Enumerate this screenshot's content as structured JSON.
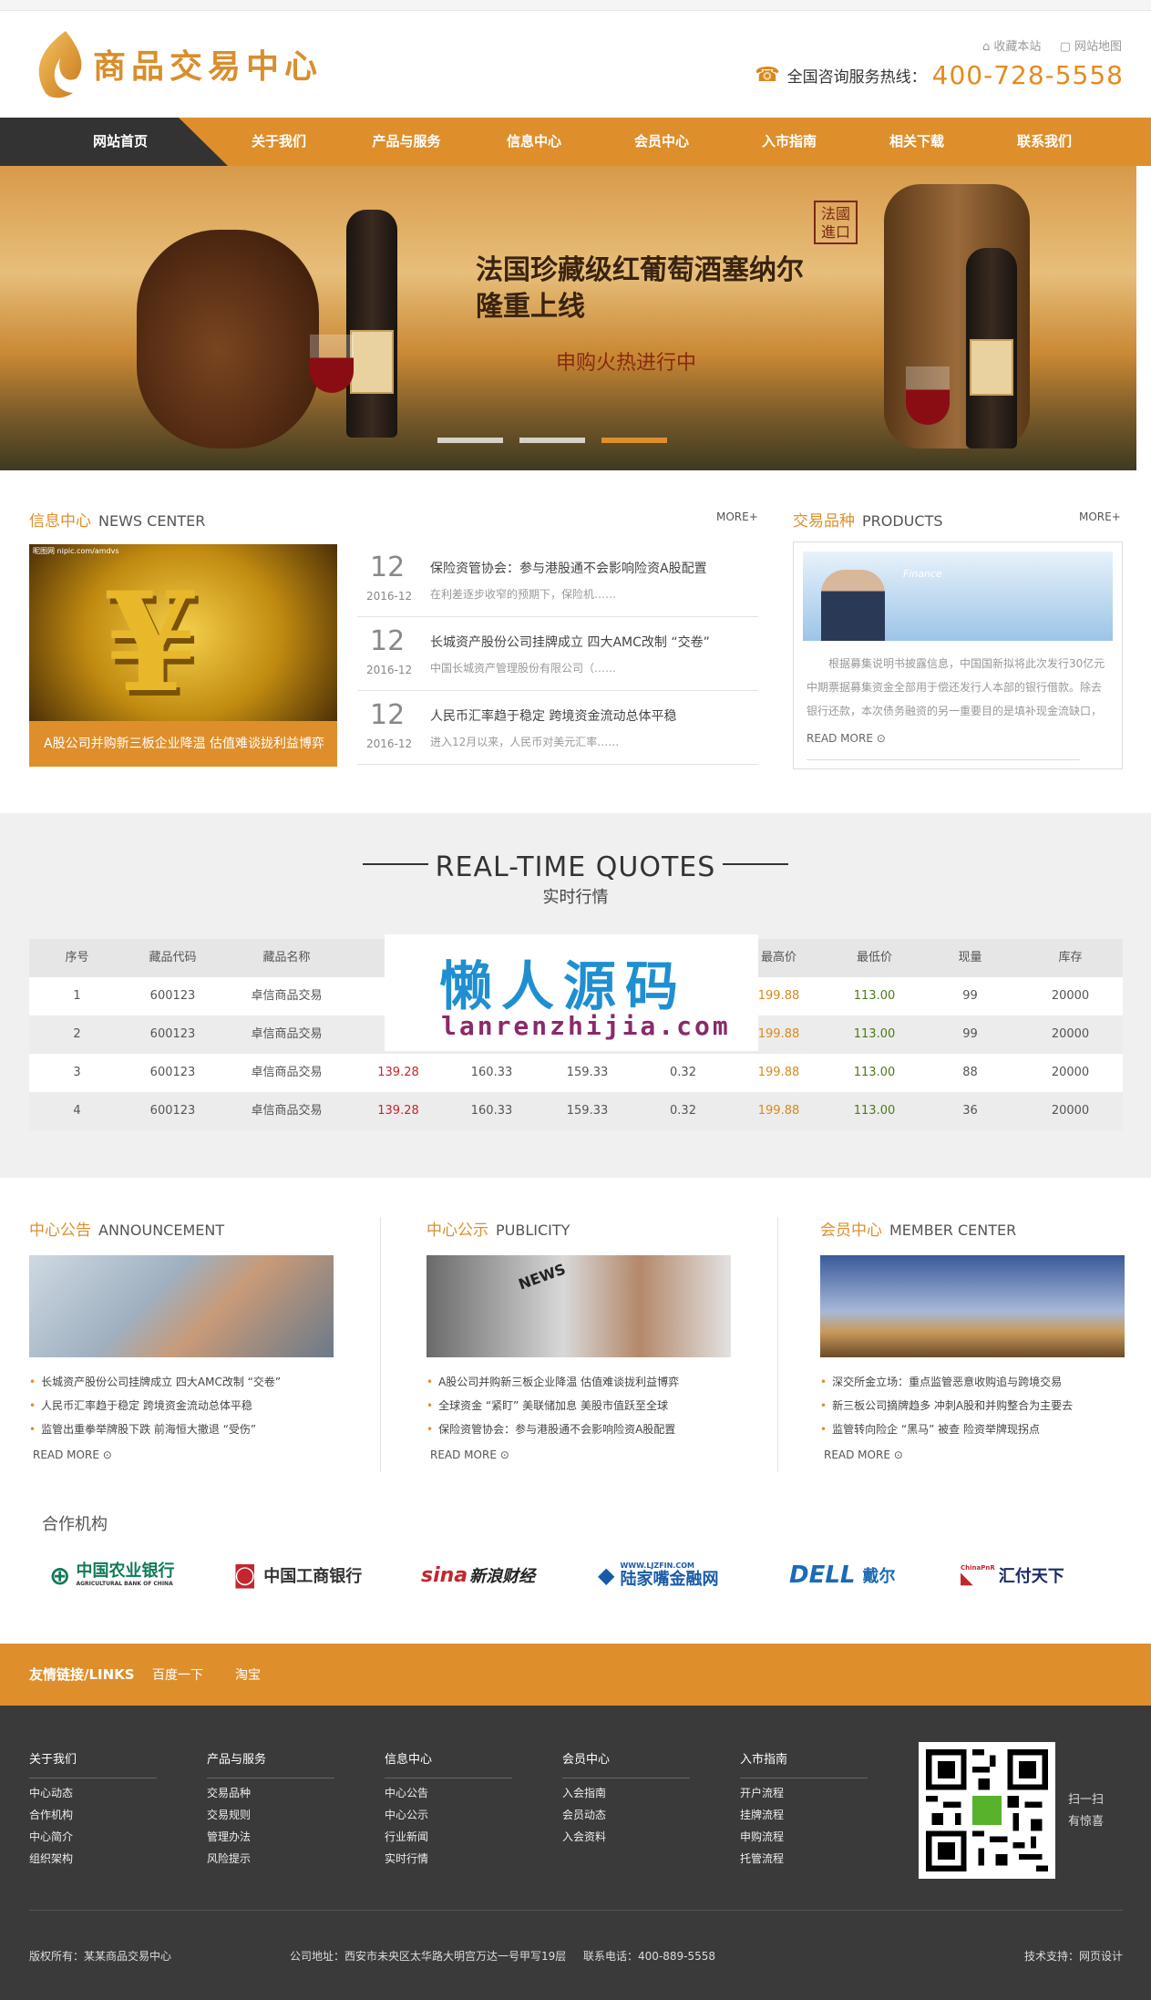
{
  "header": {
    "logo_text": "商品交易中心",
    "favorite": "收藏本站",
    "sitemap": "网站地图",
    "hotline_label": "全国咨询服务热线：",
    "hotline_number": "400-728-5558"
  },
  "nav": [
    "网站首页",
    "关于我们",
    "产品与服务",
    "信息中心",
    "会员中心",
    "入市指南",
    "相关下载",
    "联系我们"
  ],
  "banner": {
    "headline1": "法国珍藏级红葡萄酒塞纳尔",
    "headline2": "隆重上线",
    "sub": "申购火热进行中",
    "stamp": "法國進口",
    "active_slide": 3,
    "slide_count": 3
  },
  "news": {
    "title": "信息中心",
    "title_en": "NEWS CENTER",
    "more": "MORE+",
    "image_caption": "A股公司并购新三板企业降温 估值难谈拢利益博弈",
    "image_watermark": "昵图网 nipic.com/amdvs",
    "items": [
      {
        "day": "12",
        "ym": "2016-12",
        "title": "保险资管协会：参与港股通不会影响险资A股配置",
        "desc": "在利差逐步收窄的预期下，保险机……"
      },
      {
        "day": "12",
        "ym": "2016-12",
        "title": "长城资产股份公司挂牌成立 四大AMC改制 “交卷”",
        "desc": "中国长城资产管理股份有限公司（……"
      },
      {
        "day": "12",
        "ym": "2016-12",
        "title": "人民币汇率趋于稳定 跨境资金流动总体平稳",
        "desc": "进入12月以来，人民币对美元汇率……"
      }
    ]
  },
  "products": {
    "title": "交易品种",
    "title_en": "PRODUCTS",
    "more": "MORE+",
    "image_text": "Finance",
    "text": "根据募集说明书披露信息，中国国新拟将此次发行30亿元中期票据募集资金全部用于偿还发行人本部的银行借款。除去银行还款，本次债务融资的另一重要目的是填补现金流缺口，",
    "read_more": "READ MORE"
  },
  "quotes": {
    "title": "REAL-TIME QUOTES",
    "subtitle": "实时行情",
    "headers": [
      "序号",
      "藏品代码",
      "藏品名称",
      "",
      "",
      "",
      "",
      "最高价",
      "最低价",
      "现量",
      "库存"
    ],
    "rows": [
      [
        "1",
        "600123",
        "卓信商品交易",
        "",
        "",
        "",
        "",
        "199.88",
        "113.00",
        "99",
        "20000"
      ],
      [
        "2",
        "600123",
        "卓信商品交易",
        "",
        "",
        "",
        "",
        "199.88",
        "113.00",
        "99",
        "20000"
      ],
      [
        "3",
        "600123",
        "卓信商品交易",
        "139.28",
        "160.33",
        "159.33",
        "0.32",
        "199.88",
        "113.00",
        "88",
        "20000"
      ],
      [
        "4",
        "600123",
        "卓信商品交易",
        "139.28",
        "160.33",
        "159.33",
        "0.32",
        "199.88",
        "113.00",
        "36",
        "20000"
      ]
    ],
    "watermark_big": "懒人源码",
    "watermark_small": "lanrenzhijia.com"
  },
  "announcement": {
    "title": "中心公告",
    "title_en": "ANNOUNCEMENT",
    "items": [
      "长城资产股份公司挂牌成立 四大AMC改制 “交卷”",
      "人民币汇率趋于稳定 跨境资金流动总体平稳",
      "监管出重拳举牌股下跌 前海恒大撤退 “受伤”"
    ],
    "read_more": "READ MORE"
  },
  "publicity": {
    "title": "中心公示",
    "title_en": "PUBLICITY",
    "image_text": "NEWS",
    "items": [
      "A股公司并购新三板企业降温 估值难谈拢利益博弈",
      "全球资金 “紧盯” 美联储加息 美股市值跃至全球",
      "保险资管协会：参与港股通不会影响险资A股配置"
    ],
    "read_more": "READ MORE"
  },
  "member": {
    "title": "会员中心",
    "title_en": "MEMBER CENTER",
    "items": [
      "深交所金立场：重点监管恶意收购追与跨境交易",
      "新三板公司摘牌趋多 冲刺A股和并购整合为主要去",
      "监管转向险企 “黑马” 被查 险资举牌现拐点"
    ],
    "read_more": "READ MORE"
  },
  "partners": {
    "title": "合作机构",
    "logos": [
      {
        "name": "中国农业银行",
        "sub": "AGRICULTURAL BANK OF CHINA",
        "color": "#0f7a5a"
      },
      {
        "name": "中国工商银行",
        "sub": "",
        "color": "#c4262e"
      },
      {
        "name": "新浪财经",
        "sub": "sina",
        "color": "#c4262e"
      },
      {
        "name": "陆家嘴金融网",
        "sub": "WWW.LJZFIN.COM",
        "color": "#1a5aa8"
      },
      {
        "name": "戴尔",
        "sub": "DELL",
        "color": "#1a6ab8"
      },
      {
        "name": "汇付天下",
        "sub": "ChinaPnR",
        "color": "#1a2a6a"
      }
    ]
  },
  "links": {
    "title": "友情链接/LINKS",
    "items": [
      "百度一下",
      "淘宝"
    ]
  },
  "footer": {
    "cols": [
      {
        "title": "关于我们",
        "items": [
          "中心动态",
          "合作机构",
          "中心简介",
          "组织架构"
        ]
      },
      {
        "title": "产品与服务",
        "items": [
          "交易品种",
          "交易规则",
          "管理办法",
          "风险提示"
        ]
      },
      {
        "title": "信息中心",
        "items": [
          "中心公告",
          "中心公示",
          "行业新闻",
          "实时行情"
        ]
      },
      {
        "title": "会员中心",
        "items": [
          "入会指南",
          "会员动态",
          "入会资料"
        ]
      },
      {
        "title": "入市指南",
        "items": [
          "开户流程",
          "挂牌流程",
          "申购流程",
          "托管流程"
        ]
      }
    ],
    "qr_text1": "扫一扫",
    "qr_text2": "有惊喜",
    "copyright": "版权所有：某某商品交易中心",
    "address": "公司地址：西安市未央区太华路大明宫万达一号甲写19层",
    "phone": "联系电话：400-889-5558",
    "support": "技术支持：网页设计"
  },
  "colors": {
    "accent": "#de8f2c",
    "dark": "#333333",
    "footer": "#3a3a3a",
    "price_red": "#c4262e",
    "price_orange": "#d9891c",
    "price_green": "#4d7a18"
  }
}
